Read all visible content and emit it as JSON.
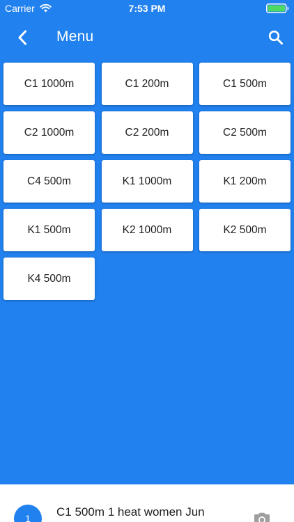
{
  "status_bar": {
    "carrier": "Carrier",
    "time": "7:53 PM",
    "battery_color": "#4CD964"
  },
  "app_bar": {
    "title": "Menu",
    "background": "#2181EE"
  },
  "tiles": [
    {
      "label": "C1 1000m"
    },
    {
      "label": "C1 200m"
    },
    {
      "label": "C1 500m"
    },
    {
      "label": "C2 1000m"
    },
    {
      "label": "C2 200m"
    },
    {
      "label": "C2 500m"
    },
    {
      "label": "C4 500m"
    },
    {
      "label": "K1 1000m"
    },
    {
      "label": "K1 200m"
    },
    {
      "label": "K1 500m"
    },
    {
      "label": "K2 1000m"
    },
    {
      "label": "K2 500m"
    },
    {
      "label": "K4 500m"
    }
  ],
  "bottom_list": {
    "first_item": {
      "index": "1",
      "title": "C1 500m 1 heat women Jun"
    }
  },
  "icons": {
    "back": "chevron-left-icon",
    "search": "search-icon",
    "wifi": "wifi-icon",
    "battery": "battery-icon",
    "camera": "camera-icon"
  }
}
